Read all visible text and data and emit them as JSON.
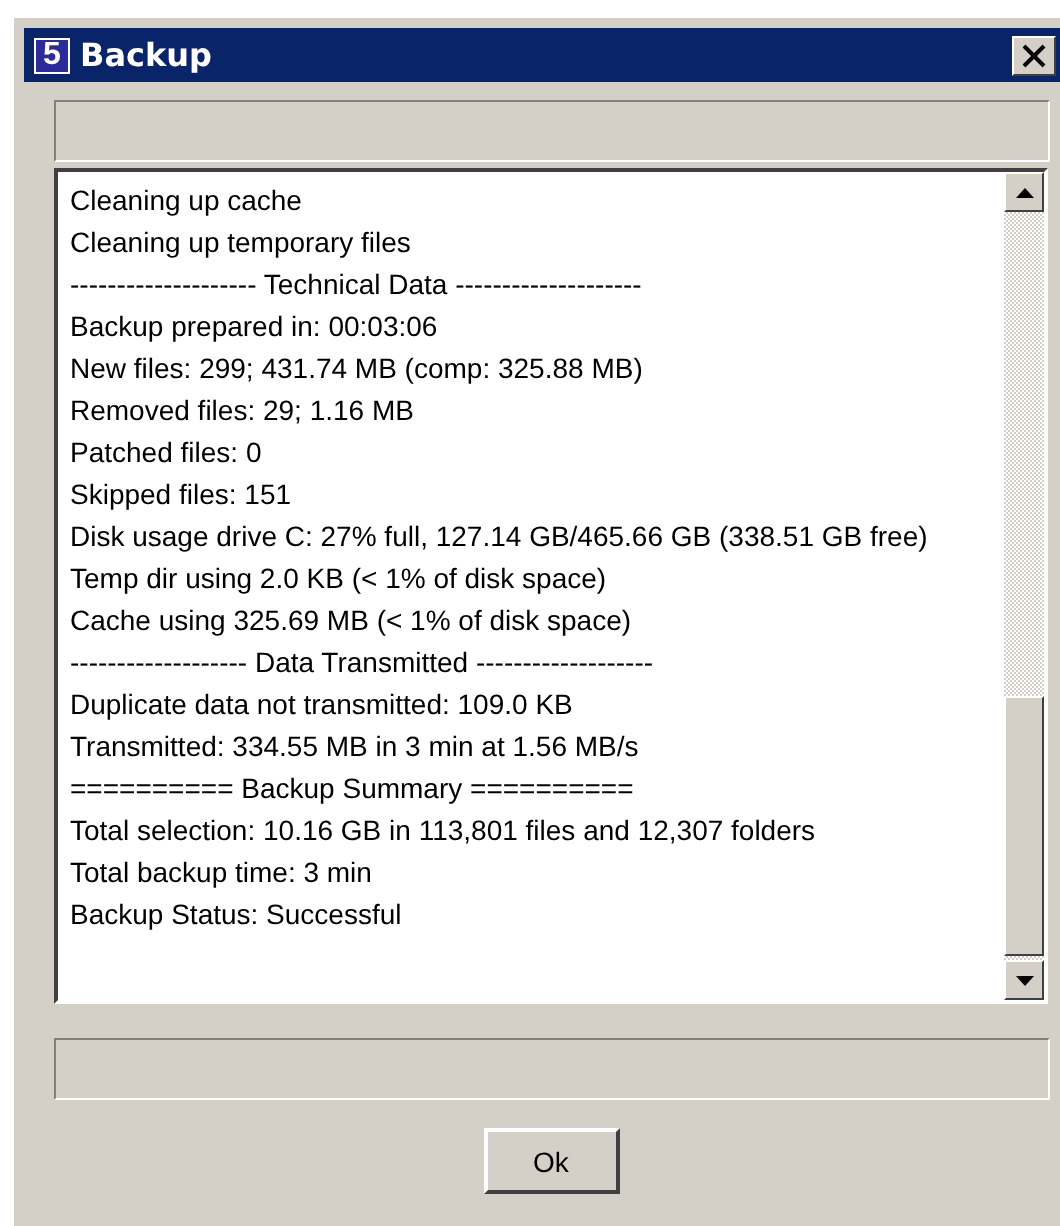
{
  "window": {
    "title": "Backup",
    "icon_text": "5"
  },
  "log": {
    "lines": [
      "Cleaning up cache",
      "Cleaning up temporary files",
      "-------------------- Technical Data --------------------",
      "Backup prepared in: 00:03:06",
      "New files: 299; 431.74 MB (comp: 325.88 MB)",
      "Removed files: 29; 1.16 MB",
      "Patched files: 0",
      "Skipped files: 151",
      "Disk usage drive C: 27% full, 127.14 GB/465.66 GB (338.51 GB free)",
      "Temp dir using 2.0 KB (< 1% of disk space)",
      "Cache using 325.69 MB (< 1% of disk space)",
      "------------------- Data Transmitted -------------------",
      "Duplicate data not transmitted: 109.0 KB",
      "Transmitted: 334.55 MB in 3 min at 1.56 MB/s",
      "========== Backup Summary ==========",
      "Total selection: 10.16 GB in 113,801 files and 12,307 folders",
      "Total backup time: 3 min",
      "Backup Status: Successful"
    ]
  },
  "buttons": [
    {
      "label": "Ok"
    }
  ]
}
